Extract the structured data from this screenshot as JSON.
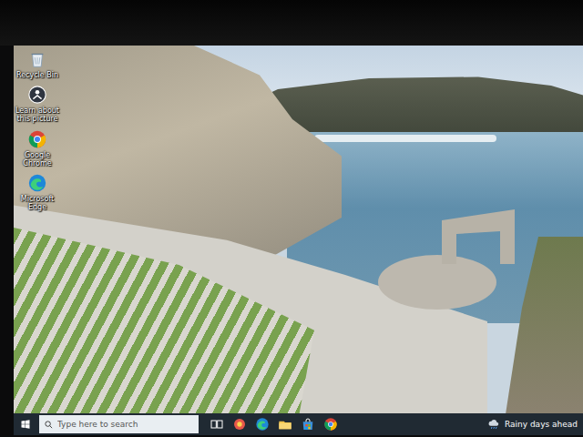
{
  "desktop": {
    "icons": [
      {
        "label": "Recycle Bin",
        "kind": "recycle"
      },
      {
        "label": "Learn about this picture",
        "kind": "spotlight"
      },
      {
        "label": "Google Chrome",
        "kind": "chrome"
      },
      {
        "label": "Microsoft Edge",
        "kind": "edge"
      }
    ]
  },
  "taskbar": {
    "search": {
      "placeholder": "Type here to search"
    },
    "weather": "Rainy days ahead"
  }
}
